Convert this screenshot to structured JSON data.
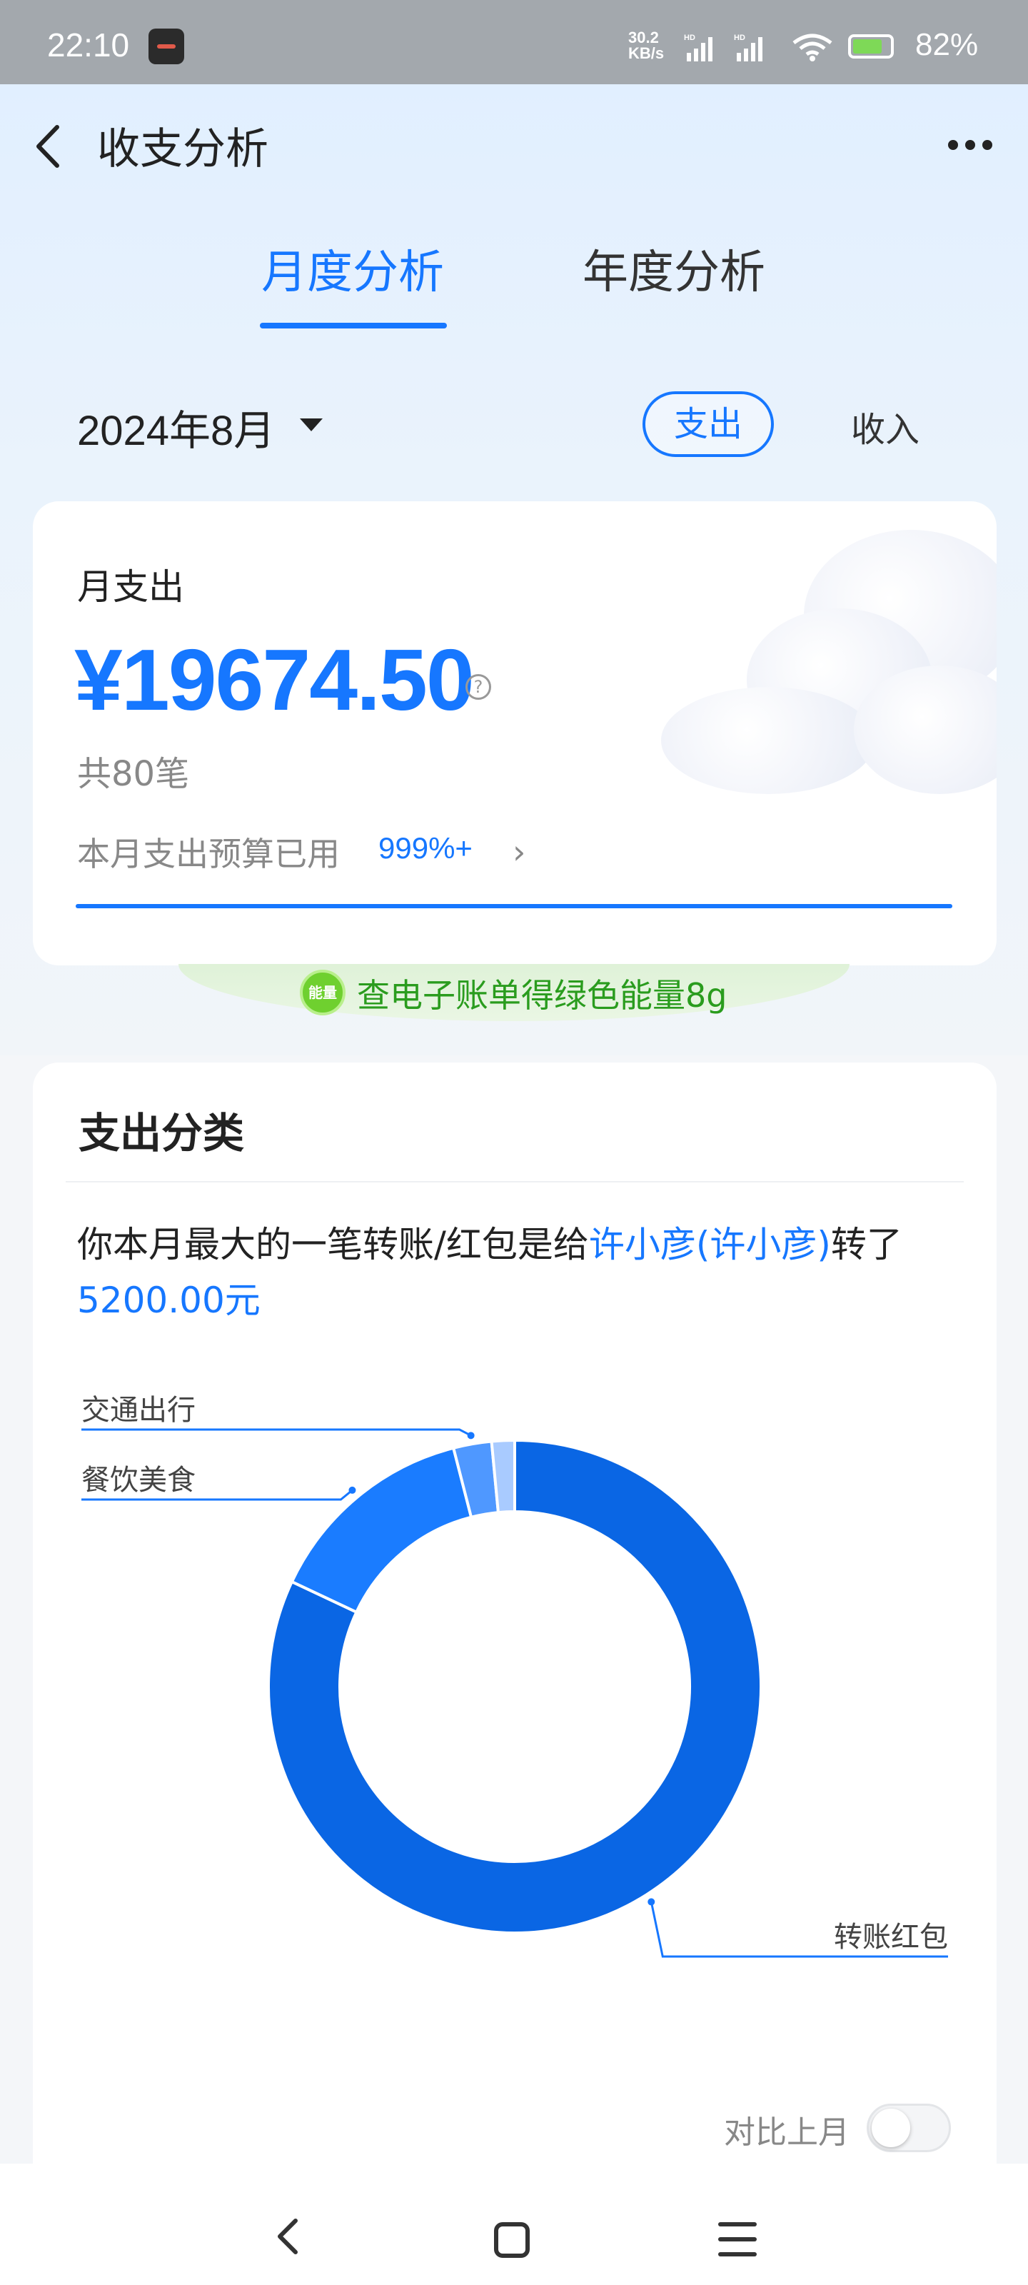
{
  "status_bar": {
    "time": "22:10",
    "net_speed": "30.2",
    "net_unit": "KB/s",
    "battery": "82%"
  },
  "header": {
    "title": "收支分析"
  },
  "tabs": [
    {
      "label": "月度分析",
      "active": true
    },
    {
      "label": "年度分析",
      "active": false
    }
  ],
  "filter": {
    "month": "2024年8月",
    "expense_label": "支出",
    "income_label": "收入"
  },
  "summary": {
    "label": "月支出",
    "amount": "¥19674.50",
    "count": "共80笔",
    "budget_label": "本月支出预算已用",
    "budget_value": "999%+",
    "budget_progress": 1.0
  },
  "energy_banner": {
    "icon_text": "能量",
    "text": "查电子账单得绿色能量8g"
  },
  "category": {
    "title": "支出分类",
    "insight": {
      "prefix": "你本月最大的一笔转账/红包是给",
      "person": "许小彦(许小彦)",
      "mid": "转了",
      "amount": "5200.00元"
    },
    "compare_label": "对比上月",
    "compare_enabled": false
  },
  "chart_data": {
    "type": "pie",
    "donut": true,
    "slices": [
      {
        "label": "转账红包",
        "share": 0.82,
        "color": "#0a66e4"
      },
      {
        "label": "餐饮美食",
        "share": 0.14,
        "color": "#1a7cff"
      },
      {
        "label": "交通出行",
        "share": 0.025,
        "color": "#4f98ff"
      },
      {
        "label": "",
        "share": 0.015,
        "color": "#a9cbff"
      }
    ]
  }
}
